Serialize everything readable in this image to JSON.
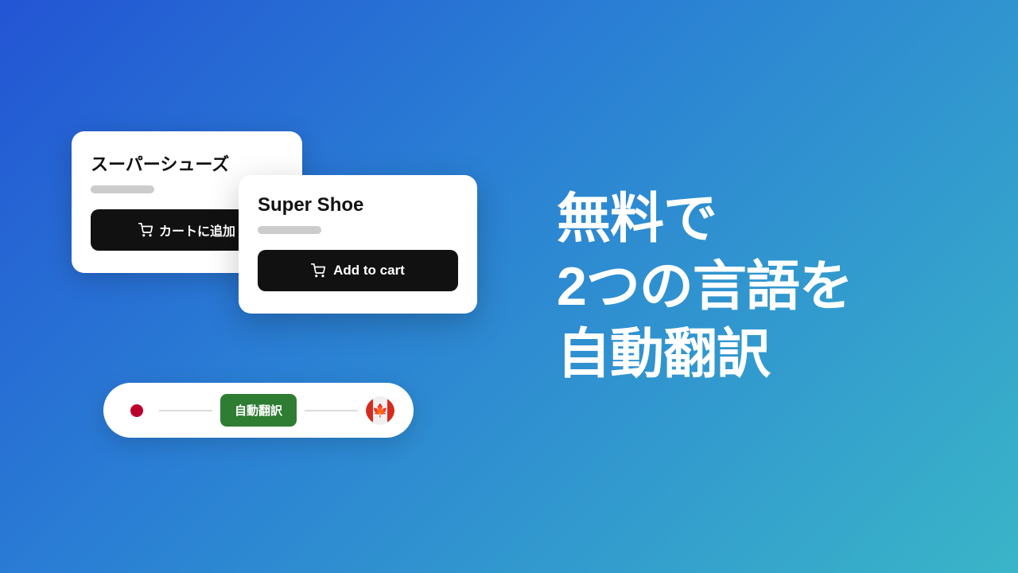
{
  "background": {
    "gradient_start": "#2355d4",
    "gradient_end": "#3ab5c8"
  },
  "japanese_card": {
    "title": "スーパーシューズ",
    "add_btn_label": "カートに追加"
  },
  "english_card": {
    "title": "Super Shoe",
    "add_btn_label": "Add to cart"
  },
  "translation_bar": {
    "btn_label": "自動翻訳",
    "flag_jp_aria": "日本語フラグ",
    "flag_ca_aria": "カナダフラグ",
    "flag_ca_emoji": "🍁"
  },
  "headline": {
    "line1": "無料で",
    "line2": "2つの言語を",
    "line3": "自動翻訳"
  }
}
